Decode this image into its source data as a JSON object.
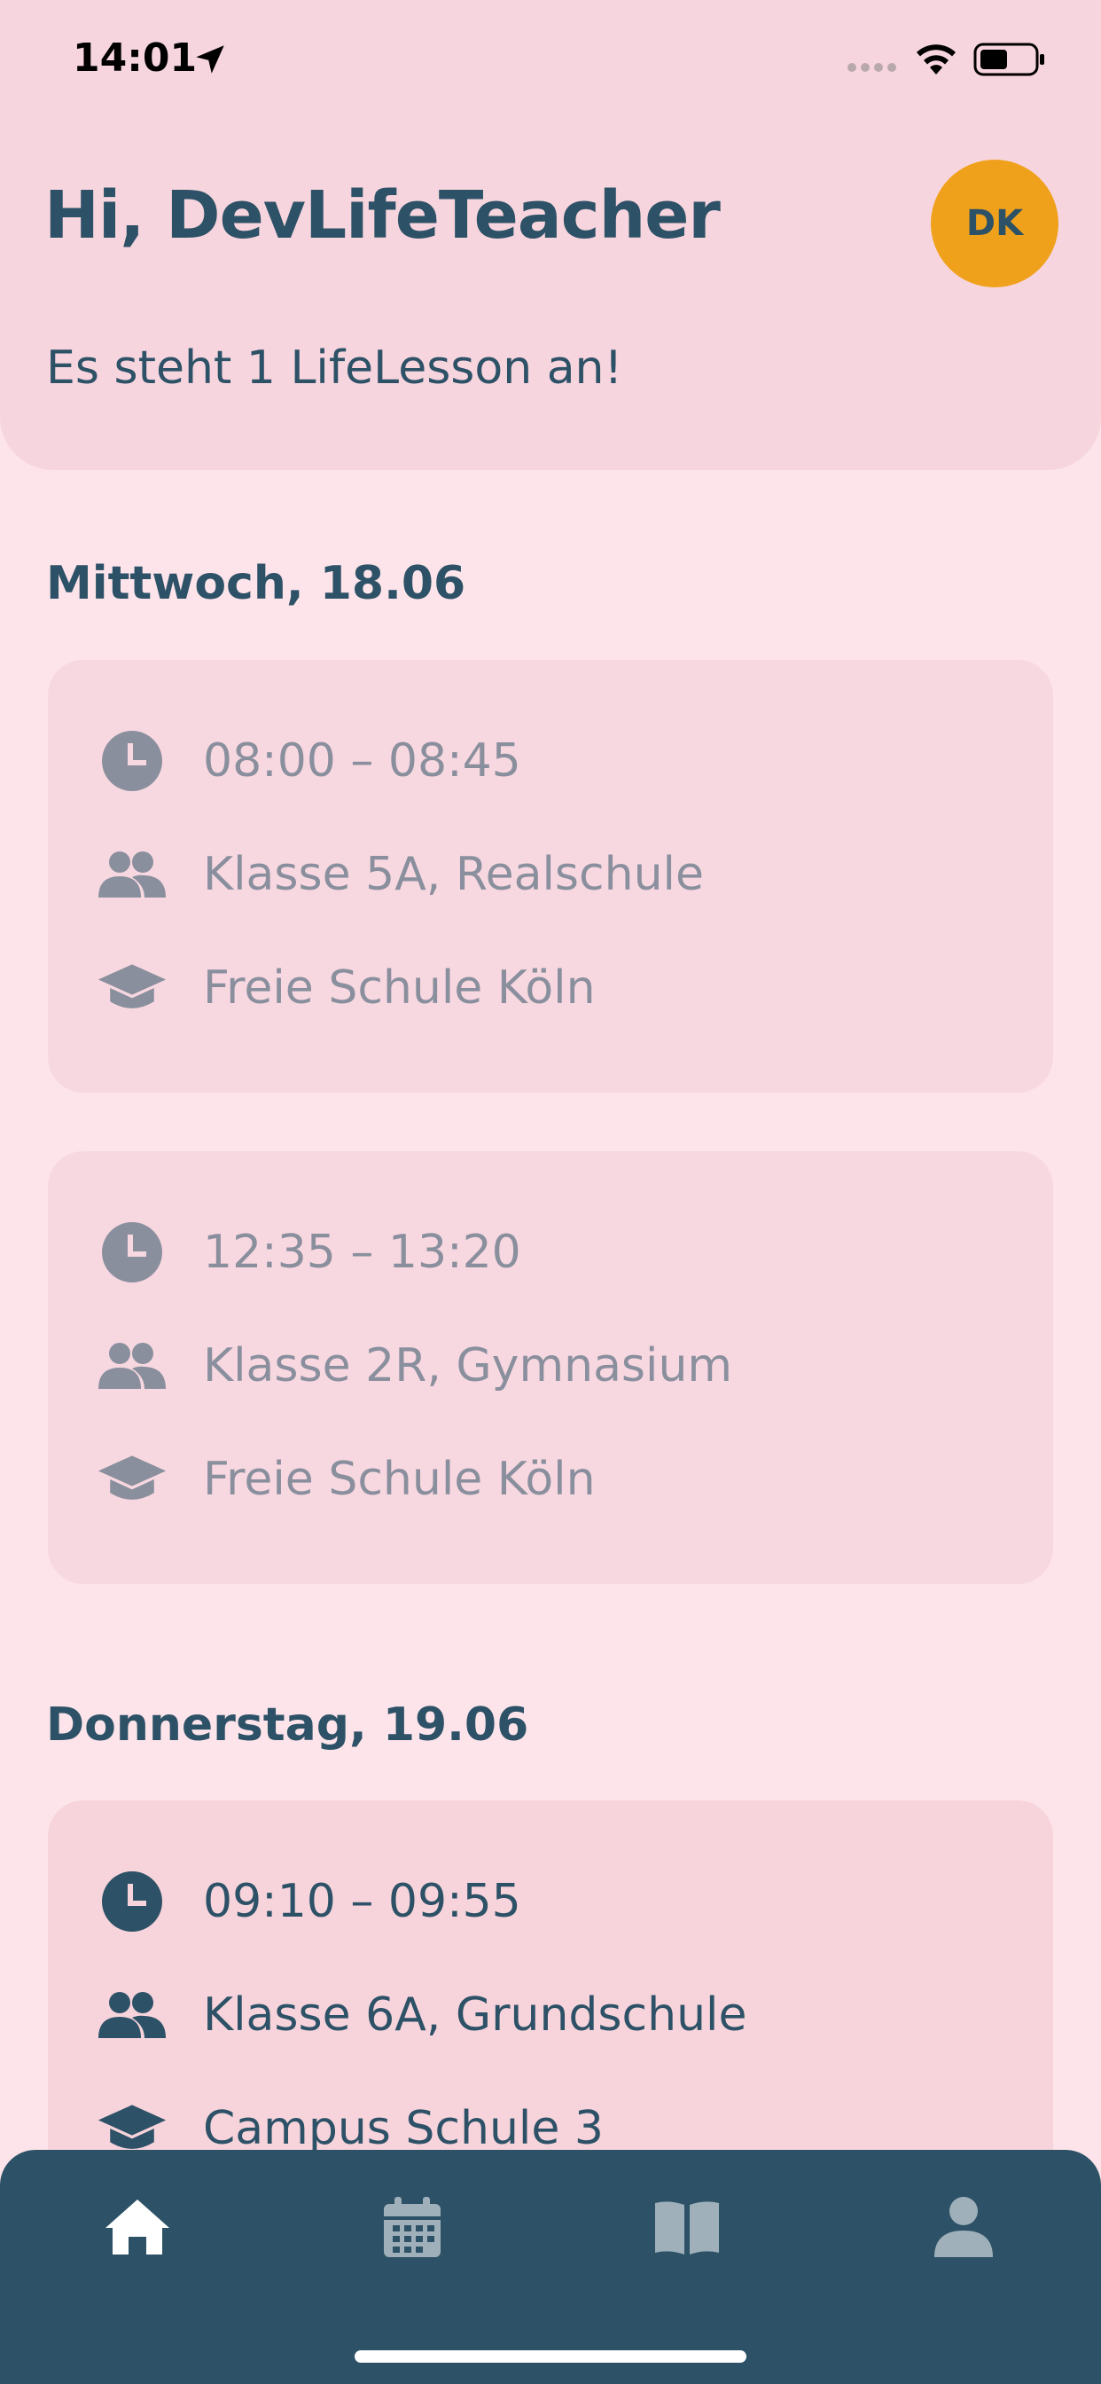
{
  "status_bar": {
    "time": "14:01"
  },
  "header": {
    "greeting": "Hi, DevLifeTeacher",
    "avatar_initials": "DK",
    "subtitle": "Es steht 1 LifeLesson an!"
  },
  "days": [
    {
      "heading": "Mittwoch, 18.06",
      "lessons": [
        {
          "time": "08:00 – 08:45",
          "class": "Klasse 5A, Realschule",
          "school": "Freie Schule Köln"
        },
        {
          "time": "12:35 – 13:20",
          "class": "Klasse 2R, Gymnasium",
          "school": "Freie Schule Köln"
        }
      ]
    },
    {
      "heading": "Donnerstag, 19.06",
      "lessons": [
        {
          "time": "09:10 – 09:55",
          "class": "Klasse 6A, Grundschule",
          "school": "Campus Schule 3"
        }
      ]
    }
  ],
  "tab_bar": {
    "items": [
      {
        "icon": "home-icon",
        "active": true
      },
      {
        "icon": "calendar-icon",
        "active": false
      },
      {
        "icon": "book-icon",
        "active": false
      },
      {
        "icon": "profile-icon",
        "active": false
      }
    ]
  },
  "colors": {
    "background": "#fde4ea",
    "header": "#f7d5de",
    "primary": "#2d5166",
    "muted": "#8a8f9e",
    "avatar": "#efa11b"
  }
}
